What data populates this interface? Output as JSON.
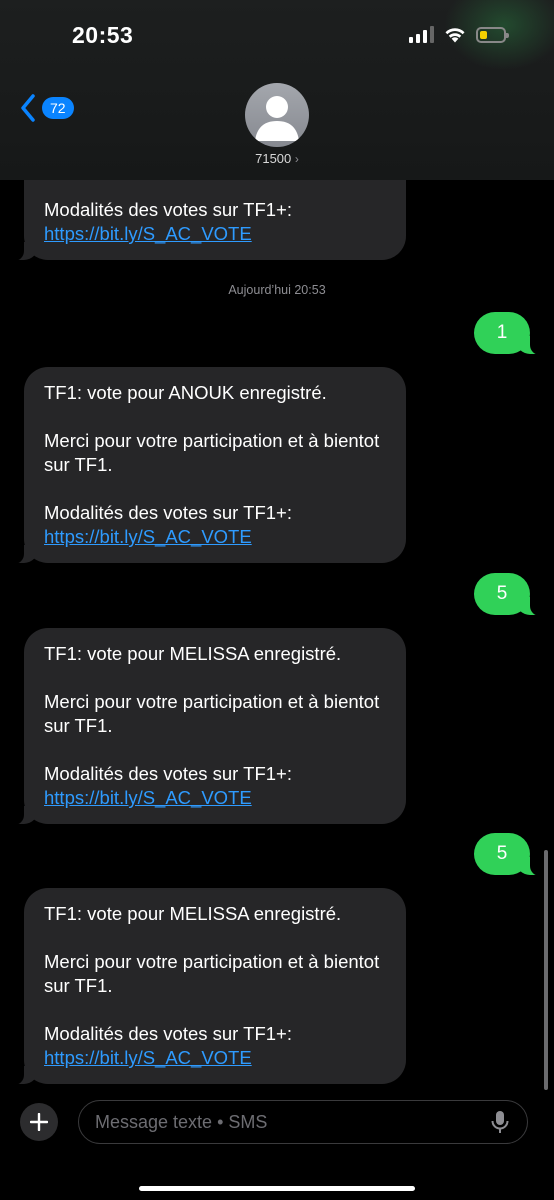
{
  "status_bar": {
    "time": "20:53"
  },
  "header": {
    "back_count": "72",
    "contact": "71500",
    "contact_chevron": "›"
  },
  "thread": {
    "top_partial": {
      "text": "Modalités des votes sur TF1+: ",
      "link": "https://bit.ly/S_AC_VOTE"
    },
    "timestamp": "Aujourd’hui 20:53",
    "messages": [
      {
        "from": "me",
        "text": "1"
      },
      {
        "from": "them",
        "lines": [
          "TF1: vote pour ANOUK enregistré.",
          "Merci pour votre participation et à bientot sur TF1.",
          "Modalités des votes sur TF1+: "
        ],
        "link": "https://bit.ly/S_AC_VOTE"
      },
      {
        "from": "me",
        "text": "5"
      },
      {
        "from": "them",
        "lines": [
          "TF1: vote pour MELISSA enregistré.",
          "Merci pour votre participation et à bientot sur TF1.",
          "Modalités des votes sur TF1+: "
        ],
        "link": "https://bit.ly/S_AC_VOTE"
      },
      {
        "from": "me",
        "text": "5"
      },
      {
        "from": "them",
        "lines": [
          "TF1: vote pour MELISSA enregistré.",
          "Merci pour votre participation et à bientot sur TF1.",
          "Modalités des votes sur TF1+: "
        ],
        "link": "https://bit.ly/S_AC_VOTE"
      }
    ]
  },
  "composer": {
    "placeholder": "Message texte • SMS"
  },
  "icons": {
    "back": "chevron-left-icon",
    "avatar": "person-icon",
    "plus": "plus-icon",
    "mic": "microphone-icon",
    "signal": "cellular-signal-icon",
    "wifi": "wifi-icon",
    "battery": "battery-icon"
  },
  "colors": {
    "outgoing_bubble": "#30d158",
    "incoming_bubble": "#262628",
    "link": "#2e9bff",
    "badge": "#0a84ff",
    "battery_level": "#f5d000"
  },
  "battery_level_fraction": 0.2
}
